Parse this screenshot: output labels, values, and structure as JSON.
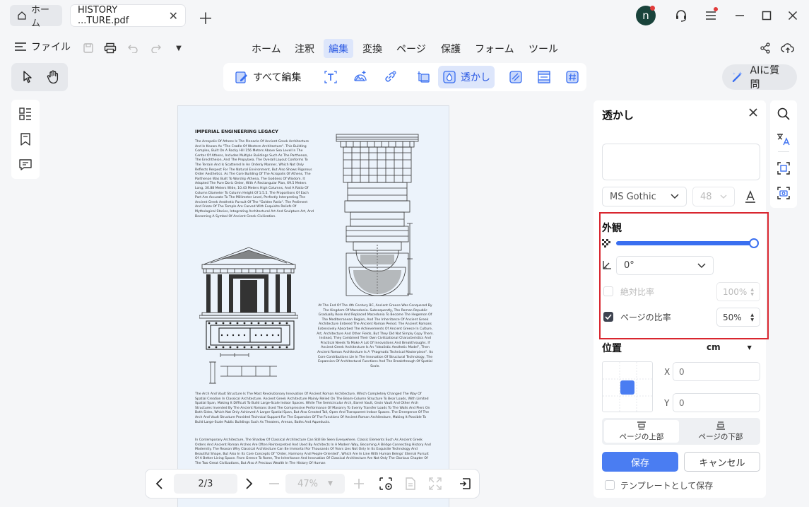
{
  "titlebar": {
    "home_tab": "ホーム",
    "file_tab": "HISTORY ...TURE.pdf",
    "avatar_initial": "n"
  },
  "menubar": {
    "file_label": "ファイル",
    "items": [
      "ホーム",
      "注釈",
      "編集",
      "変換",
      "ページ",
      "保護",
      "フォーム",
      "ツール"
    ],
    "active_item": "編集"
  },
  "toolbar": {
    "edit_all": "すべて編集",
    "watermark": "透かし",
    "ai_label": "AIに質問"
  },
  "document": {
    "title": "IMPERIAL ENGINEERING LEGACY",
    "para1": "The Acropolis Of Athens Is The Pinnacle Of Ancient Greek Architecture And Is Known As \"The Cradle Of Western Architecture\". This Building Complex, Built On A Rocky Hill 156 Meters Above Sea Level In The Center Of Athens, Includes Multiple Buildings Such As The Parthenon, The Erechtheion, And The Propylaea. The Overall Layout Conforms To The Terrain And Is Scattered In An Orderly Manner, Which Not Only Reflects Respect For The Natural Environment, But Also Shows Rigorous Order Aesthetics. As The Core Building Of The Acropolis Of Athens, The Parthenon Was Built To Worship Athena, The Goddess Of Wisdom. It Adopted The Pure Doric Order, With A Rectangular Plan, 69.5 Meters Long, 30.88 Meters Wide, 10.43 Meters High Columns, And A Ratio Of Column Diameter To Column Height Of 1:5.5. The Proportions Of Each Part Are Accurate To The Millimeter Level, Perfectly Interpreting The Ancient Greek Aesthetic Pursuit Of The \"Golden Ratio\". The Pediment And Frieze Of The Temple Are Carved With Exquisite Reliefs Of Mythological Stories, Integrating Architectural Art And Sculpture Art, And Becoming A Symbol Of Ancient Greek Civilization.",
    "para2": "At The End Of The 4th Century BC, Ancient Greece Was Conquered By The Kingdom Of Macedonia. Subsequently, The Roman Republic Gradually Rose And Replaced Macedonia To Become The Hegemon Of The Mediterranean Region, And The Inheritance Of Ancient Greek Architecture Entered The Ancient Roman Period. The Ancient Romans Extensively Absorbed The Achievements Of Ancient Greece In Culture, Art, Architecture And Other Fields, But They Did Not Simply Copy Them. Instead, They Combined Their Own Civilizational Characteristics And Practical Needs To Make A Lot Of Innovations And Breakthroughs. If Ancient Greek Architecture Is An \"Idealistic Aesthetic Model\", Then Ancient Roman Architecture Is A \"Pragmatic Technical Masterpiece\". Its Core Contributions Lie In The Innovation Of Structural Technology, The Expansion Of Architectural Functions And The Breakthrough Of Spatial Scale.",
    "para3": "The Arch And Vault Structure Is The Most Revolutionary Innovation Of Ancient Roman Architecture, Which Completely Changed The Way Of Spatial Creation In Classical Architecture. Ancient Greek Architecture Mainly Relied On The Beam-Column Structure To Bear Loads, With Limited Spatial Span, Making It Difficult To Build Large-Scale Indoor Spaces. While The Semicircular Arch, Barrel Vault, Groin Vault And Other Arch Structures Invented By The Ancient Romans Used The Compressive Performance Of Masonry To Evenly Transfer Loads To The Walls And Piers On Both Sides, Which Not Only Achieved A Larger Spatial Span, But Also Created Tall, Open And Transparent Indoor Spaces. The Emergence Of The Arch And Vault Structure Provided Technical Support For The Expansion Of The Functions Of Ancient Roman Architecture, Making It Possible To Build Large-Scale Public Buildings Such As Theaters, Arenas, Baths And Aqueducts.",
    "para4": "In Contemporary Architecture, The Shadow Of Classical Architecture Can Still Be Seen Everywhere. Classic Elements Such As Ancient Greek Orders And Ancient Roman Arches Are Often Reinterpreted And Used By Architects In A Modern Way, Becoming A Bridge Connecting History And Modernity. The Reason Why Classical Architecture Can Be Immortal For Thousands Of Years Lies Not Only In Its Exquisite Technology And Beautiful Shape, But Also In Its Core Concepts Of \"Order, Harmony And People-Oriented\", Which Are In Line With Human Beings' Eternal Pursuit Of A Better Living Space. From Greece To Rome, The Inheritance And Innovation Of Classical Architecture Are Not Only The Glorious Chapter Of The Two Great Civilizations, But Also A Precious Wealth In The History Of Human"
  },
  "bottom_nav": {
    "page_indicator": "2/3",
    "zoom": "47%"
  },
  "panel": {
    "title": "透かし",
    "font": "MS Gothic",
    "font_size": "48",
    "appearance_title": "外観",
    "opacity_percent": 100,
    "rotation": "0°",
    "absolute_scale_label": "絶対比率",
    "absolute_scale_value": "100%",
    "page_scale_label": "ページの比率",
    "page_scale_value": "50%",
    "position_title": "位置",
    "unit": "cm",
    "x_label": "X",
    "x_value": "0",
    "y_label": "Y",
    "y_value": "0",
    "top_of_page": "ページの上部",
    "bottom_of_page": "ページの下部",
    "save": "保存",
    "cancel": "キャンセル",
    "save_template": "テンプレートとして保存"
  },
  "colors": {
    "accent": "#4a7df2",
    "highlight_border": "#d9262f",
    "avatar": "#19433b"
  }
}
